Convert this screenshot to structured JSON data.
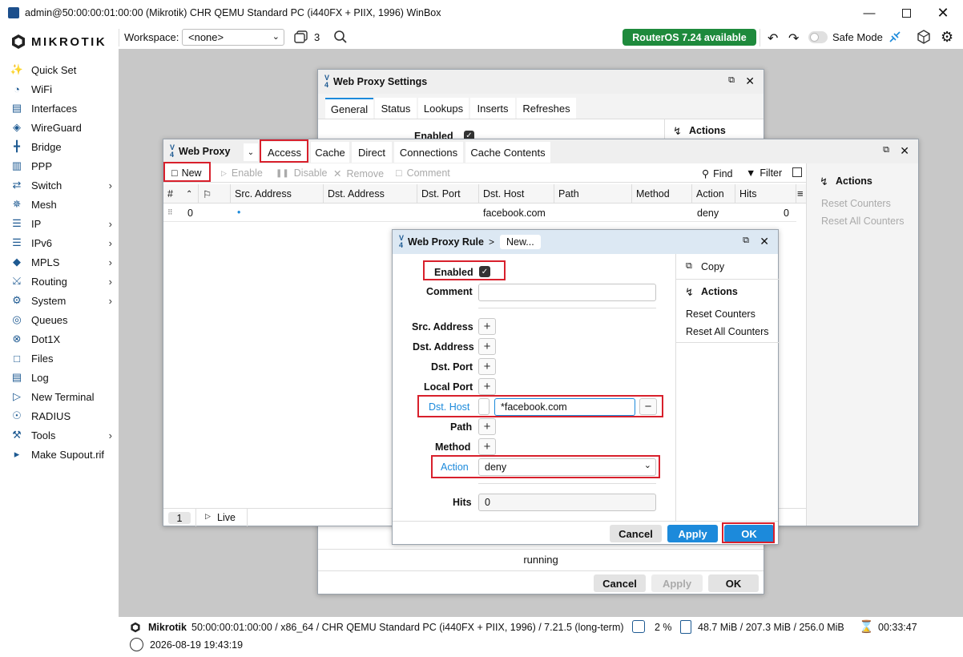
{
  "titlebar": {
    "title": "admin@50:00:00:01:00:00 (Mikrotik) CHR QEMU Standard PC (i440FX + PIIX, 1996) WinBox"
  },
  "logo": {
    "text": "MIKROTIK"
  },
  "sidebar": {
    "items": [
      {
        "label": "Quick Set",
        "icon": "quickset-icon",
        "arrow": false
      },
      {
        "label": "WiFi",
        "icon": "wifi-icon",
        "arrow": false
      },
      {
        "label": "Interfaces",
        "icon": "interfaces-icon",
        "arrow": false
      },
      {
        "label": "WireGuard",
        "icon": "wireguard-icon",
        "arrow": false
      },
      {
        "label": "Bridge",
        "icon": "bridge-icon",
        "arrow": false
      },
      {
        "label": "PPP",
        "icon": "ppp-icon",
        "arrow": false
      },
      {
        "label": "Switch",
        "icon": "switch-icon",
        "arrow": true
      },
      {
        "label": "Mesh",
        "icon": "mesh-icon",
        "arrow": false
      },
      {
        "label": "IP",
        "icon": "ip-icon",
        "arrow": true
      },
      {
        "label": "IPv6",
        "icon": "ipv6-icon",
        "arrow": true
      },
      {
        "label": "MPLS",
        "icon": "mpls-icon",
        "arrow": true
      },
      {
        "label": "Routing",
        "icon": "routing-icon",
        "arrow": true
      },
      {
        "label": "System",
        "icon": "system-icon",
        "arrow": true
      },
      {
        "label": "Queues",
        "icon": "queues-icon",
        "arrow": false
      },
      {
        "label": "Dot1X",
        "icon": "dot1x-icon",
        "arrow": false
      },
      {
        "label": "Files",
        "icon": "files-icon",
        "arrow": false
      },
      {
        "label": "Log",
        "icon": "log-icon",
        "arrow": false
      },
      {
        "label": "New Terminal",
        "icon": "terminal-icon",
        "arrow": false
      },
      {
        "label": "RADIUS",
        "icon": "radius-icon",
        "arrow": false
      },
      {
        "label": "Tools",
        "icon": "tools-icon",
        "arrow": true
      },
      {
        "label": "Make Supout.rif",
        "icon": "supout-icon",
        "arrow": false
      }
    ]
  },
  "toolbar": {
    "workspace_label": "Workspace:",
    "workspace_value": "<none>",
    "windows_count": "3",
    "update_badge": "RouterOS 7.24 available",
    "safe_mode_label": "Safe Mode"
  },
  "settings_window": {
    "title": "Web Proxy Settings",
    "tabs": [
      "General",
      "Status",
      "Lookups",
      "Inserts",
      "Refreshes"
    ],
    "enabled_label": "Enabled",
    "actions_label": "Actions",
    "status_text": "running",
    "cancel_label": "Cancel",
    "apply_label": "Apply",
    "ok_label": "OK"
  },
  "proxy_window": {
    "title": "Web Proxy",
    "tabs": [
      "Access",
      "Cache",
      "Direct",
      "Connections",
      "Cache Contents"
    ],
    "toolbar": {
      "new": "New",
      "enable": "Enable",
      "disable": "Disable",
      "remove": "Remove",
      "comment": "Comment",
      "find": "Find",
      "filter": "Filter"
    },
    "columns": [
      "#",
      "Src. Address",
      "Dst. Address",
      "Dst. Port",
      "Dst. Host",
      "Path",
      "Method",
      "Action",
      "Hits"
    ],
    "rows": [
      {
        "num": "0",
        "src": "•",
        "dst_host": "facebook.com",
        "action": "deny",
        "hits": "0"
      }
    ],
    "actions_label": "Actions",
    "reset_counters": "Reset Counters",
    "reset_all_counters": "Reset All Counters",
    "footer_count": "1",
    "footer_live": "Live"
  },
  "rule_dialog": {
    "title": "Web Proxy Rule",
    "breadcrumb_sep": ">",
    "breadcrumb_item": "New...",
    "enabled_label": "Enabled",
    "comment_label": "Comment",
    "comment_value": "",
    "src_address_label": "Src. Address",
    "dst_address_label": "Dst. Address",
    "dst_port_label": "Dst. Port",
    "local_port_label": "Local Port",
    "dst_host_label": "Dst. Host",
    "dst_host_value": "*facebook.com",
    "path_label": "Path",
    "method_label": "Method",
    "action_label": "Action",
    "action_value": "deny",
    "hits_label": "Hits",
    "hits_value": "0",
    "copy_label": "Copy",
    "actions_label": "Actions",
    "reset_counters": "Reset Counters",
    "reset_all_counters": "Reset All Counters",
    "cancel_label": "Cancel",
    "apply_label": "Apply",
    "ok_label": "OK"
  },
  "statusbar": {
    "identity": "Mikrotik",
    "info": "50:00:00:01:00:00 / x86_64 / CHR QEMU Standard PC (i440FX + PIIX, 1996) / 7.21.5 (long-term)",
    "cpu": "2 %",
    "memory": "48.7 MiB / 207.3 MiB / 256.0 MiB",
    "uptime": "00:33:47",
    "datetime": "2026-08-19 19:43:19"
  },
  "colors": {
    "accent": "#1c8adb",
    "highlight": "#d8202c",
    "update_badge": "#1e8a3c",
    "sidebar_icon": "#1e5a92"
  }
}
